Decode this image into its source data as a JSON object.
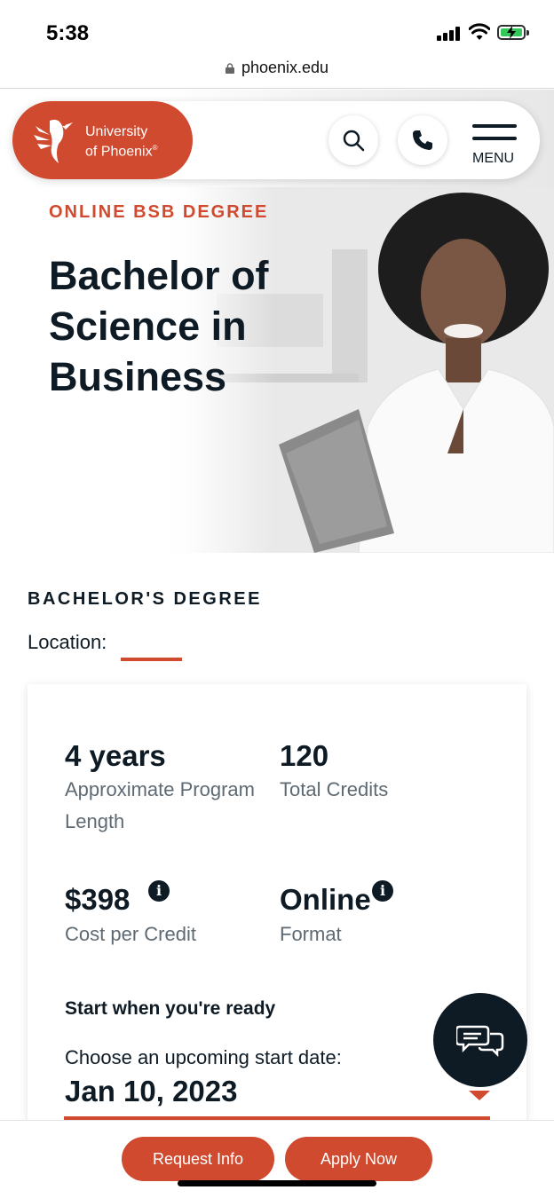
{
  "status_bar": {
    "time": "5:38"
  },
  "browser": {
    "url": "phoenix.edu"
  },
  "header": {
    "logo_line1": "University",
    "logo_line2": "of Phoenix",
    "logo_mark": "®",
    "menu_label": "MENU"
  },
  "hero": {
    "eyebrow": "ONLINE BSB DEGREE",
    "title_line1": "Bachelor of",
    "title_line2": "Science in",
    "title_line3": "Business"
  },
  "degree": {
    "label": "BACHELOR'S DEGREE",
    "location_label": "Location:",
    "location_value": ""
  },
  "stats": [
    {
      "value": "4 years",
      "label": "Approximate Program Length"
    },
    {
      "value": "120",
      "label": "Total Credits"
    },
    {
      "value": "$398",
      "label": "Cost per Credit"
    },
    {
      "value": "Online",
      "label": "Format"
    }
  ],
  "start": {
    "heading": "Start when you're ready",
    "prompt": "Choose an upcoming start date:",
    "selected_date": "Jan 10, 2023"
  },
  "actions": {
    "request_info": "Request Info",
    "apply_now": "Apply Now"
  },
  "icons": {
    "info": "i",
    "search": "search-icon",
    "phone": "phone-icon",
    "menu": "hamburger-icon",
    "chat": "chat-icon"
  },
  "colors": {
    "brand": "#d04a2f",
    "ink": "#0e1b25",
    "muted": "#5e6a73"
  }
}
